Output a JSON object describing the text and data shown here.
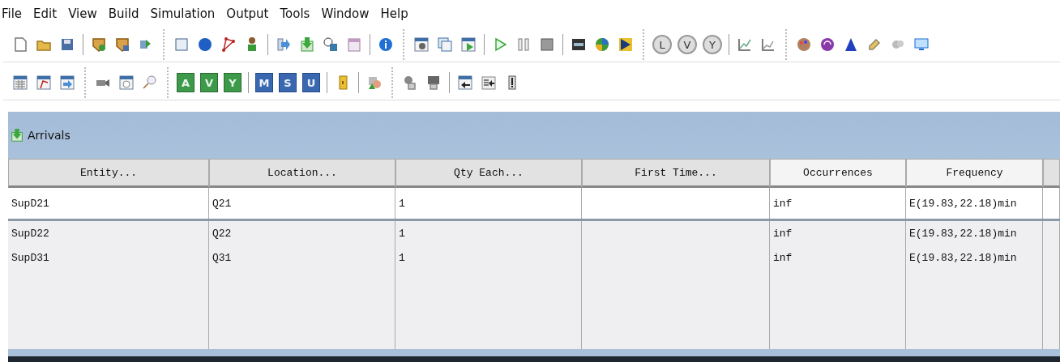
{
  "menu": [
    "File",
    "Edit",
    "View",
    "Build",
    "Simulation",
    "Output",
    "Tools",
    "Window",
    "Help"
  ],
  "toolbars": [
    {
      "labels": [
        "L",
        "V",
        "Y"
      ]
    },
    {
      "labels": [
        "A",
        "V",
        "Y",
        "M",
        "S",
        "U"
      ]
    }
  ],
  "panel": {
    "title": "Arrivals"
  },
  "table": {
    "columns": [
      {
        "label": "Entity...",
        "kind": "dialog"
      },
      {
        "label": "Location...",
        "kind": "dialog"
      },
      {
        "label": "Qty Each...",
        "kind": "dialog"
      },
      {
        "label": "First Time...",
        "kind": "dialog"
      },
      {
        "label": "Occurrences",
        "kind": "plain"
      },
      {
        "label": "Frequency",
        "kind": "plain"
      }
    ],
    "rows": [
      {
        "selected": true,
        "cells": [
          "SupD21",
          "Q21",
          "1",
          "",
          "inf",
          "E(19.83,22.18)min"
        ]
      },
      {
        "selected": false,
        "cells": [
          "SupD22",
          "Q22",
          "1",
          "",
          "inf",
          "E(19.83,22.18)min"
        ]
      },
      {
        "selected": false,
        "cells": [
          "SupD31",
          "Q31",
          "1",
          "",
          "inf",
          "E(19.83,22.18)min"
        ]
      }
    ]
  }
}
